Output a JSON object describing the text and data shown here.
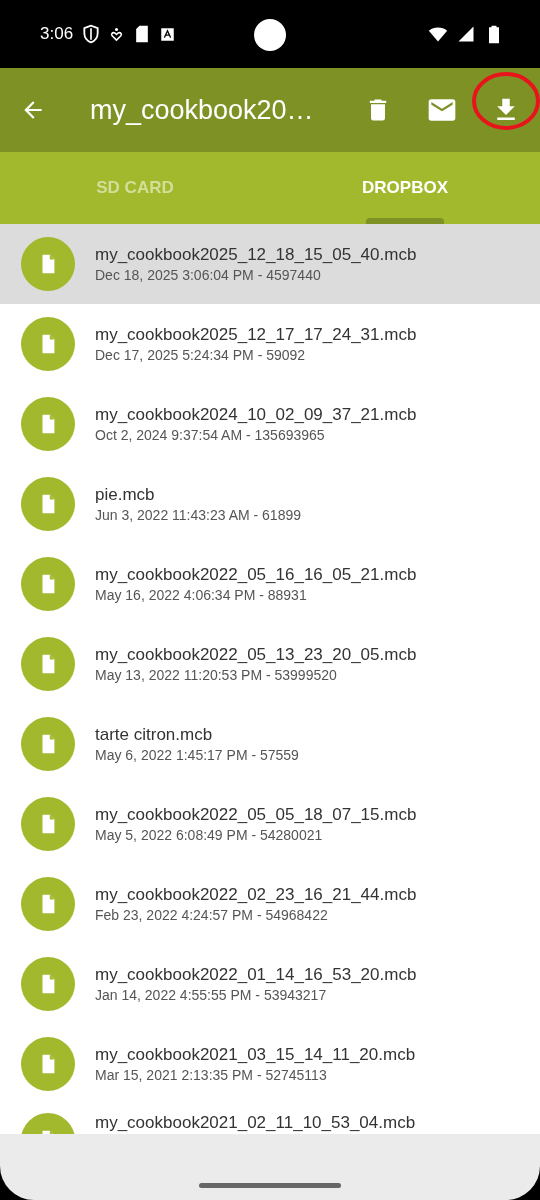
{
  "status_bar": {
    "time": "3:06"
  },
  "toolbar": {
    "title": "my_cookbook20…",
    "actions": [
      {
        "kind": "delete",
        "highlighted": false
      },
      {
        "kind": "mail",
        "highlighted": false
      },
      {
        "kind": "download",
        "highlighted": true
      }
    ]
  },
  "tabs": [
    {
      "label": "SD CARD",
      "selected": false
    },
    {
      "label": "DROPBOX",
      "selected": true
    }
  ],
  "files": [
    {
      "name": "my_cookbook2025_12_18_15_05_40.mcb",
      "details": "Dec 18, 2025 3:06:04 PM - 4597440",
      "selected": true
    },
    {
      "name": "my_cookbook2025_12_17_17_24_31.mcb",
      "details": "Dec 17, 2025 5:24:34 PM - 59092",
      "selected": false
    },
    {
      "name": "my_cookbook2024_10_02_09_37_21.mcb",
      "details": "Oct 2, 2024 9:37:54 AM - 135693965",
      "selected": false
    },
    {
      "name": "pie.mcb",
      "details": "Jun 3, 2022 11:43:23 AM - 61899",
      "selected": false
    },
    {
      "name": "my_cookbook2022_05_16_16_05_21.mcb",
      "details": "May 16, 2022 4:06:34 PM - 88931",
      "selected": false
    },
    {
      "name": "my_cookbook2022_05_13_23_20_05.mcb",
      "details": "May 13, 2022 11:20:53 PM - 53999520",
      "selected": false
    },
    {
      "name": "tarte citron.mcb",
      "details": "May 6, 2022 1:45:17 PM - 57559",
      "selected": false
    },
    {
      "name": "my_cookbook2022_05_05_18_07_15.mcb",
      "details": "May 5, 2022 6:08:49 PM - 54280021",
      "selected": false
    },
    {
      "name": "my_cookbook2022_02_23_16_21_44.mcb",
      "details": "Feb 23, 2022 4:24:57 PM - 54968422",
      "selected": false
    },
    {
      "name": "my_cookbook2022_01_14_16_53_20.mcb",
      "details": "Jan 14, 2022 4:55:55 PM - 53943217",
      "selected": false
    },
    {
      "name": "my_cookbook2021_03_15_14_11_20.mcb",
      "details": "Mar 15, 2021 2:13:35 PM - 52745113",
      "selected": false
    },
    {
      "name": "my_cookbook2021_02_11_10_53_04.mcb",
      "selected": false
    }
  ]
}
